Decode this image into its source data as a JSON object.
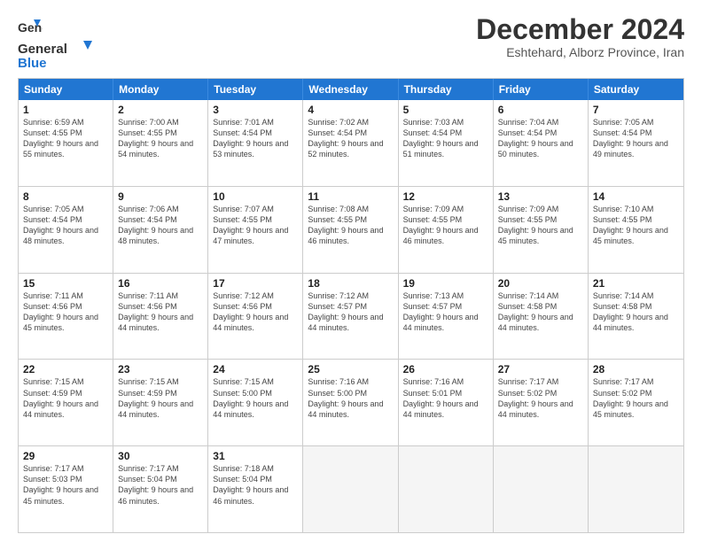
{
  "logo": {
    "text_general": "General",
    "text_blue": "Blue"
  },
  "title": "December 2024",
  "location": "Eshtehard, Alborz Province, Iran",
  "header_days": [
    "Sunday",
    "Monday",
    "Tuesday",
    "Wednesday",
    "Thursday",
    "Friday",
    "Saturday"
  ],
  "weeks": [
    [
      {
        "day": "1",
        "rise": "Sunrise: 6:59 AM",
        "set": "Sunset: 4:55 PM",
        "daylight": "Daylight: 9 hours and 55 minutes."
      },
      {
        "day": "2",
        "rise": "Sunrise: 7:00 AM",
        "set": "Sunset: 4:55 PM",
        "daylight": "Daylight: 9 hours and 54 minutes."
      },
      {
        "day": "3",
        "rise": "Sunrise: 7:01 AM",
        "set": "Sunset: 4:54 PM",
        "daylight": "Daylight: 9 hours and 53 minutes."
      },
      {
        "day": "4",
        "rise": "Sunrise: 7:02 AM",
        "set": "Sunset: 4:54 PM",
        "daylight": "Daylight: 9 hours and 52 minutes."
      },
      {
        "day": "5",
        "rise": "Sunrise: 7:03 AM",
        "set": "Sunset: 4:54 PM",
        "daylight": "Daylight: 9 hours and 51 minutes."
      },
      {
        "day": "6",
        "rise": "Sunrise: 7:04 AM",
        "set": "Sunset: 4:54 PM",
        "daylight": "Daylight: 9 hours and 50 minutes."
      },
      {
        "day": "7",
        "rise": "Sunrise: 7:05 AM",
        "set": "Sunset: 4:54 PM",
        "daylight": "Daylight: 9 hours and 49 minutes."
      }
    ],
    [
      {
        "day": "8",
        "rise": "Sunrise: 7:05 AM",
        "set": "Sunset: 4:54 PM",
        "daylight": "Daylight: 9 hours and 48 minutes."
      },
      {
        "day": "9",
        "rise": "Sunrise: 7:06 AM",
        "set": "Sunset: 4:54 PM",
        "daylight": "Daylight: 9 hours and 48 minutes."
      },
      {
        "day": "10",
        "rise": "Sunrise: 7:07 AM",
        "set": "Sunset: 4:55 PM",
        "daylight": "Daylight: 9 hours and 47 minutes."
      },
      {
        "day": "11",
        "rise": "Sunrise: 7:08 AM",
        "set": "Sunset: 4:55 PM",
        "daylight": "Daylight: 9 hours and 46 minutes."
      },
      {
        "day": "12",
        "rise": "Sunrise: 7:09 AM",
        "set": "Sunset: 4:55 PM",
        "daylight": "Daylight: 9 hours and 46 minutes."
      },
      {
        "day": "13",
        "rise": "Sunrise: 7:09 AM",
        "set": "Sunset: 4:55 PM",
        "daylight": "Daylight: 9 hours and 45 minutes."
      },
      {
        "day": "14",
        "rise": "Sunrise: 7:10 AM",
        "set": "Sunset: 4:55 PM",
        "daylight": "Daylight: 9 hours and 45 minutes."
      }
    ],
    [
      {
        "day": "15",
        "rise": "Sunrise: 7:11 AM",
        "set": "Sunset: 4:56 PM",
        "daylight": "Daylight: 9 hours and 45 minutes."
      },
      {
        "day": "16",
        "rise": "Sunrise: 7:11 AM",
        "set": "Sunset: 4:56 PM",
        "daylight": "Daylight: 9 hours and 44 minutes."
      },
      {
        "day": "17",
        "rise": "Sunrise: 7:12 AM",
        "set": "Sunset: 4:56 PM",
        "daylight": "Daylight: 9 hours and 44 minutes."
      },
      {
        "day": "18",
        "rise": "Sunrise: 7:12 AM",
        "set": "Sunset: 4:57 PM",
        "daylight": "Daylight: 9 hours and 44 minutes."
      },
      {
        "day": "19",
        "rise": "Sunrise: 7:13 AM",
        "set": "Sunset: 4:57 PM",
        "daylight": "Daylight: 9 hours and 44 minutes."
      },
      {
        "day": "20",
        "rise": "Sunrise: 7:14 AM",
        "set": "Sunset: 4:58 PM",
        "daylight": "Daylight: 9 hours and 44 minutes."
      },
      {
        "day": "21",
        "rise": "Sunrise: 7:14 AM",
        "set": "Sunset: 4:58 PM",
        "daylight": "Daylight: 9 hours and 44 minutes."
      }
    ],
    [
      {
        "day": "22",
        "rise": "Sunrise: 7:15 AM",
        "set": "Sunset: 4:59 PM",
        "daylight": "Daylight: 9 hours and 44 minutes."
      },
      {
        "day": "23",
        "rise": "Sunrise: 7:15 AM",
        "set": "Sunset: 4:59 PM",
        "daylight": "Daylight: 9 hours and 44 minutes."
      },
      {
        "day": "24",
        "rise": "Sunrise: 7:15 AM",
        "set": "Sunset: 5:00 PM",
        "daylight": "Daylight: 9 hours and 44 minutes."
      },
      {
        "day": "25",
        "rise": "Sunrise: 7:16 AM",
        "set": "Sunset: 5:00 PM",
        "daylight": "Daylight: 9 hours and 44 minutes."
      },
      {
        "day": "26",
        "rise": "Sunrise: 7:16 AM",
        "set": "Sunset: 5:01 PM",
        "daylight": "Daylight: 9 hours and 44 minutes."
      },
      {
        "day": "27",
        "rise": "Sunrise: 7:17 AM",
        "set": "Sunset: 5:02 PM",
        "daylight": "Daylight: 9 hours and 44 minutes."
      },
      {
        "day": "28",
        "rise": "Sunrise: 7:17 AM",
        "set": "Sunset: 5:02 PM",
        "daylight": "Daylight: 9 hours and 45 minutes."
      }
    ],
    [
      {
        "day": "29",
        "rise": "Sunrise: 7:17 AM",
        "set": "Sunset: 5:03 PM",
        "daylight": "Daylight: 9 hours and 45 minutes."
      },
      {
        "day": "30",
        "rise": "Sunrise: 7:17 AM",
        "set": "Sunset: 5:04 PM",
        "daylight": "Daylight: 9 hours and 46 minutes."
      },
      {
        "day": "31",
        "rise": "Sunrise: 7:18 AM",
        "set": "Sunset: 5:04 PM",
        "daylight": "Daylight: 9 hours and 46 minutes."
      },
      {
        "day": "",
        "rise": "",
        "set": "",
        "daylight": ""
      },
      {
        "day": "",
        "rise": "",
        "set": "",
        "daylight": ""
      },
      {
        "day": "",
        "rise": "",
        "set": "",
        "daylight": ""
      },
      {
        "day": "",
        "rise": "",
        "set": "",
        "daylight": ""
      }
    ]
  ]
}
